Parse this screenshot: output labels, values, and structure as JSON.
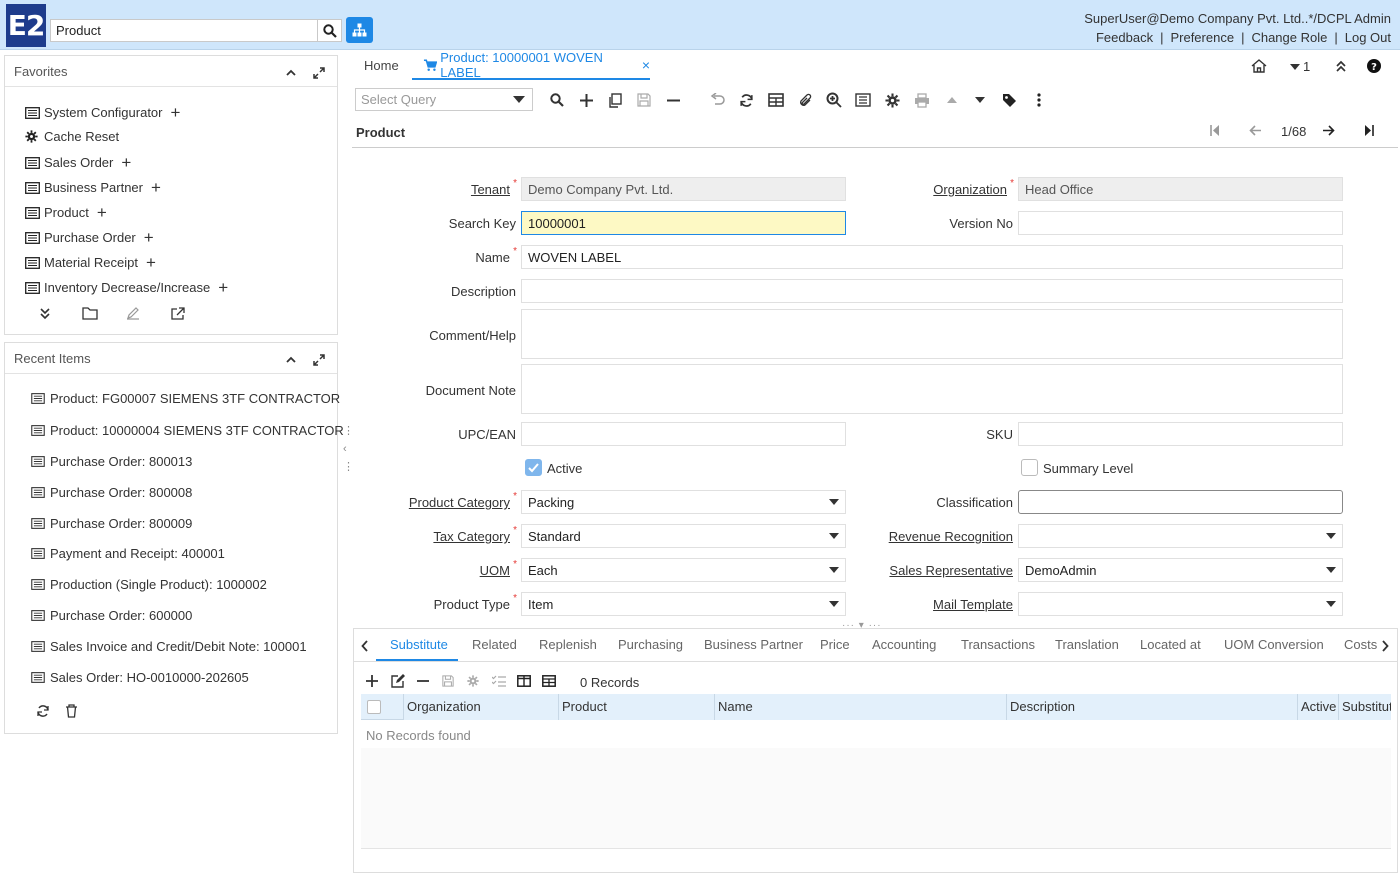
{
  "header": {
    "logo": "E2",
    "search_value": "Product",
    "user": "SuperUser@Demo Company Pvt. Ltd..*/DCPL Admin",
    "links": [
      "Feedback",
      "Preference",
      "Change Role",
      "Log Out"
    ]
  },
  "favorites": {
    "title": "Favorites",
    "items": [
      {
        "label": "System Configurator",
        "icon": "window-icon",
        "plus": true
      },
      {
        "label": "Cache Reset",
        "icon": "gear-icon",
        "plus": false
      },
      {
        "label": "Sales Order",
        "icon": "window-icon",
        "plus": true
      },
      {
        "label": "Business Partner",
        "icon": "window-icon",
        "plus": true
      },
      {
        "label": "Product",
        "icon": "window-icon",
        "plus": true
      },
      {
        "label": "Purchase Order",
        "icon": "window-icon",
        "plus": true
      },
      {
        "label": "Material Receipt",
        "icon": "window-icon",
        "plus": true
      },
      {
        "label": "Inventory Decrease/Increase",
        "icon": "window-icon",
        "plus": true
      }
    ]
  },
  "recent": {
    "title": "Recent Items",
    "items": [
      "Product: FG00007 SIEMENS 3TF CONTRACTOR",
      "Product: 10000004 SIEMENS 3TF CONTRACTOR",
      "Purchase Order: 800013",
      "Purchase Order: 800008",
      "Purchase Order: 800009",
      "Payment and Receipt: 400001",
      "Production (Single Product): 1000002",
      "Purchase Order: 600000",
      "Sales Invoice and Credit/Debit Note: 100001",
      "Sales Order: HO-0010000-202605"
    ]
  },
  "tabs": {
    "home": "Home",
    "active": "Product: 10000001 WOVEN LABEL"
  },
  "top_right": {
    "count": "1"
  },
  "toolbar": {
    "query_placeholder": "Select Query"
  },
  "window": {
    "title": "Product",
    "record_nav": "1/68"
  },
  "form": {
    "tenant_label": "Tenant",
    "tenant_value": "Demo Company Pvt. Ltd.",
    "org_label": "Organization",
    "org_value": "Head Office",
    "searchkey_label": "Search Key",
    "searchkey_value": "10000001",
    "version_label": "Version No",
    "version_value": "",
    "name_label": "Name",
    "name_value": "WOVEN LABEL",
    "description_label": "Description",
    "comment_label": "Comment/Help",
    "docnote_label": "Document Note",
    "upc_label": "UPC/EAN",
    "sku_label": "SKU",
    "active_label": "Active",
    "active_checked": true,
    "summary_label": "Summary Level",
    "summary_checked": false,
    "prodcat_label": "Product Category",
    "prodcat_value": "Packing",
    "class_label": "Classification",
    "taxcat_label": "Tax Category",
    "taxcat_value": "Standard",
    "revrec_label": "Revenue Recognition",
    "uom_label": "UOM",
    "uom_value": "Each",
    "salesrep_label": "Sales Representative",
    "salesrep_value": "DemoAdmin",
    "prodtype_label": "Product Type",
    "prodtype_value": "Item",
    "mailtpl_label": "Mail Template"
  },
  "detail": {
    "tabs": [
      "Substitute",
      "Related",
      "Replenish",
      "Purchasing",
      "Business Partner",
      "Price",
      "Accounting",
      "Transactions",
      "Translation",
      "Located at",
      "UOM Conversion",
      "Costs"
    ],
    "records": "0 Records",
    "columns": [
      "Organization",
      "Product",
      "Name",
      "Description",
      "Active",
      "Substitut"
    ],
    "empty": "No Records found"
  }
}
